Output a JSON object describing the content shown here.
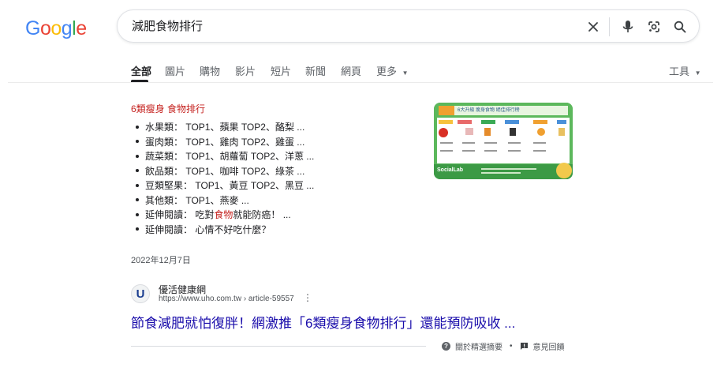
{
  "logo": {
    "letters": [
      "G",
      "o",
      "o",
      "g",
      "l",
      "e"
    ],
    "colors": [
      "#4285F4",
      "#EA4335",
      "#FBBC05",
      "#4285F4",
      "#34A853",
      "#EA4335"
    ]
  },
  "search": {
    "query": "減肥食物排行"
  },
  "tabs": [
    {
      "label": "全部",
      "active": true
    },
    {
      "label": "圖片"
    },
    {
      "label": "購物"
    },
    {
      "label": "影片"
    },
    {
      "label": "短片"
    },
    {
      "label": "新聞"
    },
    {
      "label": "網頁"
    },
    {
      "label": "更多"
    }
  ],
  "tools_label": "工具",
  "featured": {
    "title_prefix": "6類瘦身",
    "title_highlight": "食物排行",
    "items": [
      {
        "label": "水果類：",
        "text": "TOP1、蘋果 TOP2、酪梨 ..."
      },
      {
        "label": "蛋肉類：",
        "text": "TOP1、雞肉 TOP2、雞蛋 ..."
      },
      {
        "label": "蔬菜類：",
        "text": "TOP1、胡蘿蔔 TOP2、洋蔥 ..."
      },
      {
        "label": "飲品類：",
        "text": "TOP1、咖啡 TOP2、綠茶 ..."
      },
      {
        "label": "豆類堅果：",
        "text": "TOP1、黃豆 TOP2、黑豆 ..."
      },
      {
        "label": "其他類：",
        "text": "TOP1、燕麥 ..."
      },
      {
        "label": "延伸閱讀：",
        "pre": "吃對",
        "hl": "食物",
        "post": "就能防癌！ ..."
      },
      {
        "label": "延伸閱讀：",
        "text": "心情不好吃什麼？"
      }
    ],
    "date": "2022年12月7日",
    "thumb_title": "6大升級 瘦身食物 絕佳排行榜",
    "thumb_brand": "SocialLab"
  },
  "result": {
    "site_name": "優活健康網",
    "url": "https://www.uho.com.tw › article-59557",
    "favicon_letter": "U",
    "title": "節食減肥就怕復胖！網激推「6類瘦身食物排行」還能預防吸收 ..."
  },
  "footer": {
    "about": "關於精選摘要",
    "dot": "•",
    "feedback": "意見回饋"
  }
}
